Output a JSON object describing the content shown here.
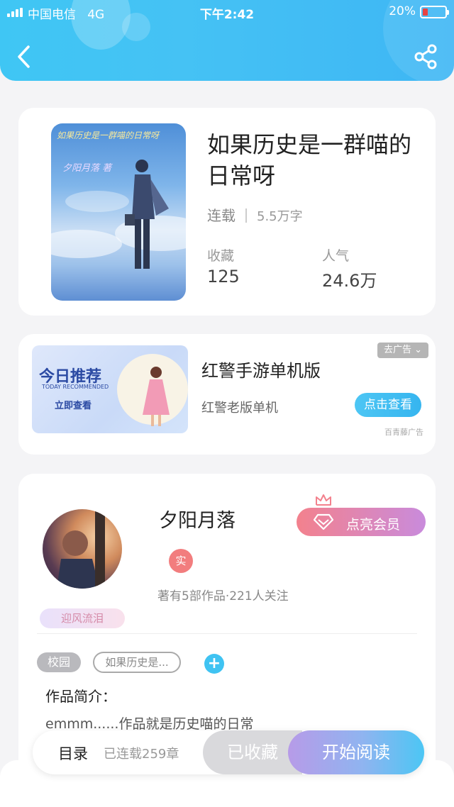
{
  "status_bar": {
    "carrier": "中国电信",
    "network": "4G",
    "time": "下午2:42",
    "battery": "20%"
  },
  "nav": {
    "back_icon": "chevron-left-icon",
    "share_icon": "share-icon"
  },
  "book": {
    "cover_title": "如果历史是一群喵的日常呀",
    "cover_author": "夕阳月落 著",
    "title": "如果历史是一群喵的日常呀",
    "status": "连载",
    "word_count": "5.5万字",
    "stats": [
      {
        "label": "收藏",
        "value": "125"
      },
      {
        "label": "人气",
        "value": "24.6万"
      }
    ]
  },
  "ad": {
    "image_title": "今日推荐",
    "image_subtitle": "TODAY RECOMMENDED",
    "image_cta": "立即查看",
    "title": "红警手游单机版",
    "subtitle": "红警老版单机",
    "button": "点击查看",
    "remove_label": "去广告",
    "source": "百青藤广告"
  },
  "author": {
    "name": "夕阳月落",
    "verified_badge": "实",
    "stats": "著有5部作品·221人关注",
    "vip_button": "点亮会员",
    "nickname_tag": "迎风流泪"
  },
  "tags": {
    "category": "校园",
    "book_tag": "如果历史是...",
    "add": "+"
  },
  "intro": {
    "label": "作品简介：",
    "text": "emmm......作品就是历史喵的日常"
  },
  "bottom_bar": {
    "toc_label": "目录",
    "chapter_count": "已连载259章",
    "collect_button": "已收藏",
    "read_button": "开始阅读"
  },
  "colors": {
    "header_blue": "#3fc6f4",
    "accent_blue": "#36b5ef",
    "vip_pink": "#f3818d",
    "vip_purple": "#c98bdc"
  }
}
